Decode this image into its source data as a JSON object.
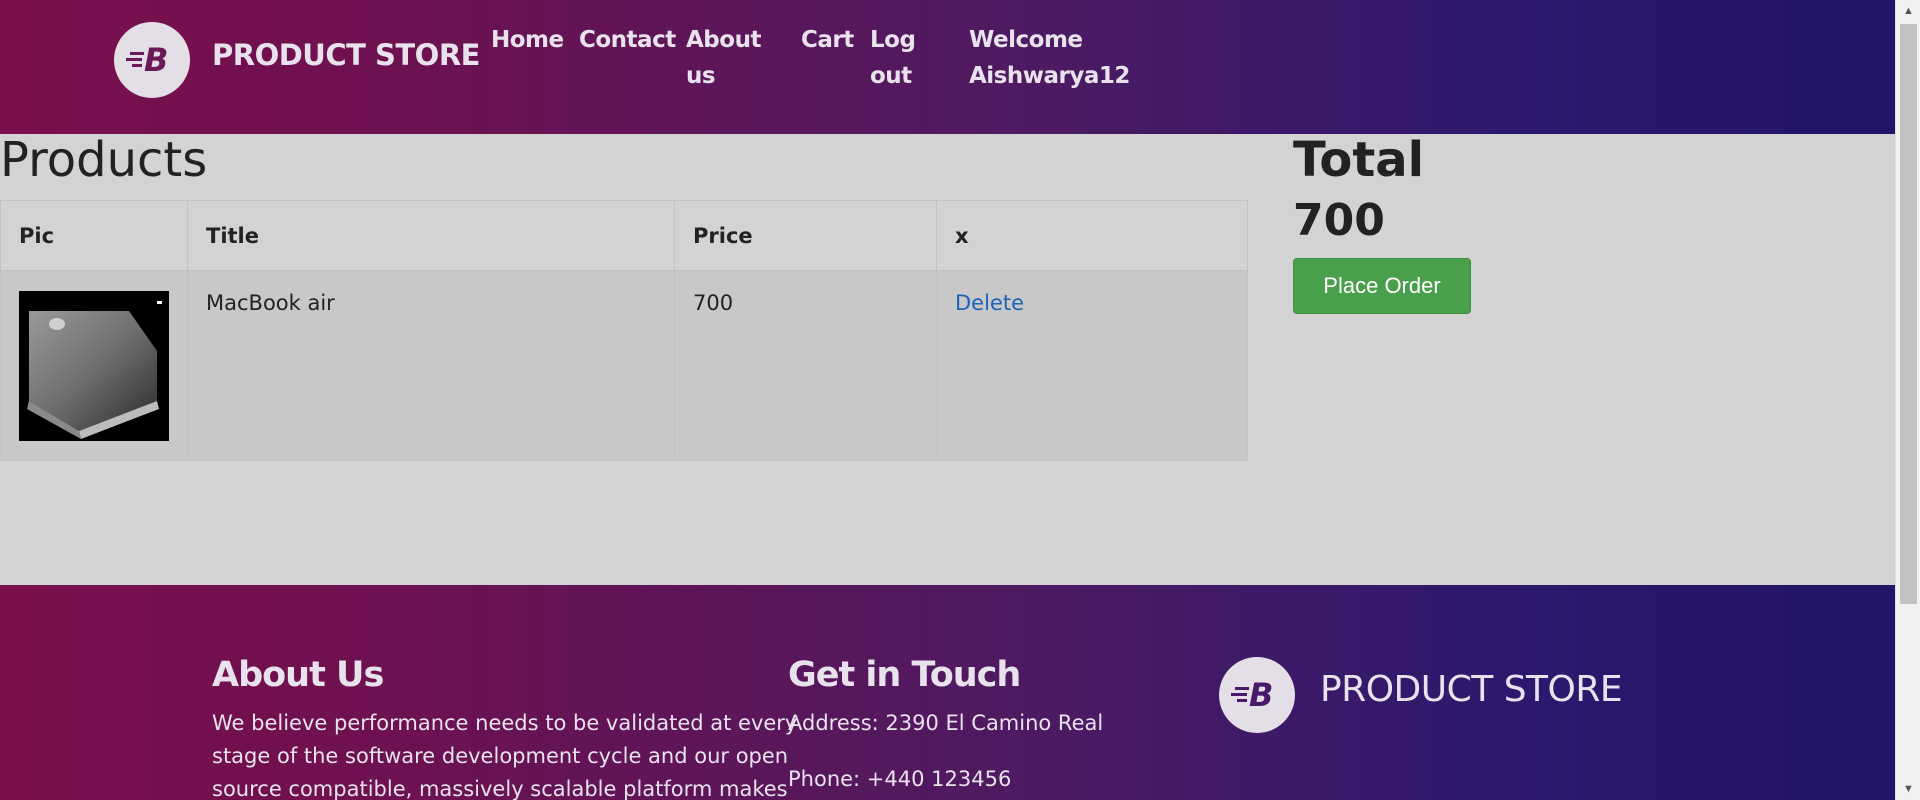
{
  "header": {
    "brand_name": "PRODUCT STORE",
    "logo_letter": "B",
    "nav": {
      "home": "Home",
      "contact": "Contact",
      "about_line1": "About",
      "about_line2": "us",
      "cart": "Cart",
      "logout_line1": "Log",
      "logout_line2": "out",
      "welcome_line1": "Welcome",
      "welcome_line2": "Aishwarya12"
    }
  },
  "products": {
    "title": "Products",
    "columns": [
      "Pic",
      "Title",
      "Price",
      "x"
    ],
    "rows": [
      {
        "pic": "macbook-air-image",
        "title": "MacBook air",
        "price": "700",
        "action": "Delete"
      }
    ]
  },
  "total": {
    "label": "Total",
    "value": "700",
    "place_order_label": "Place Order",
    "place_order_color": "#4a9f4c"
  },
  "footer": {
    "about": {
      "heading": "About Us",
      "line1": "We believe performance needs to be validated at every",
      "line2": "stage of the software development cycle and our open",
      "line3": "source compatible, massively scalable platform makes"
    },
    "contact": {
      "heading": "Get in Touch",
      "address": "Address: 2390 El Camino Real",
      "phone": "Phone: +440 123456"
    },
    "brand_name": "PRODUCT STORE",
    "logo_letter": "B"
  },
  "colors": {
    "gradient_start": "#7a0f4d",
    "gradient_end": "#221466",
    "page_bg": "#d3d3d3",
    "link": "#1e63b6"
  }
}
